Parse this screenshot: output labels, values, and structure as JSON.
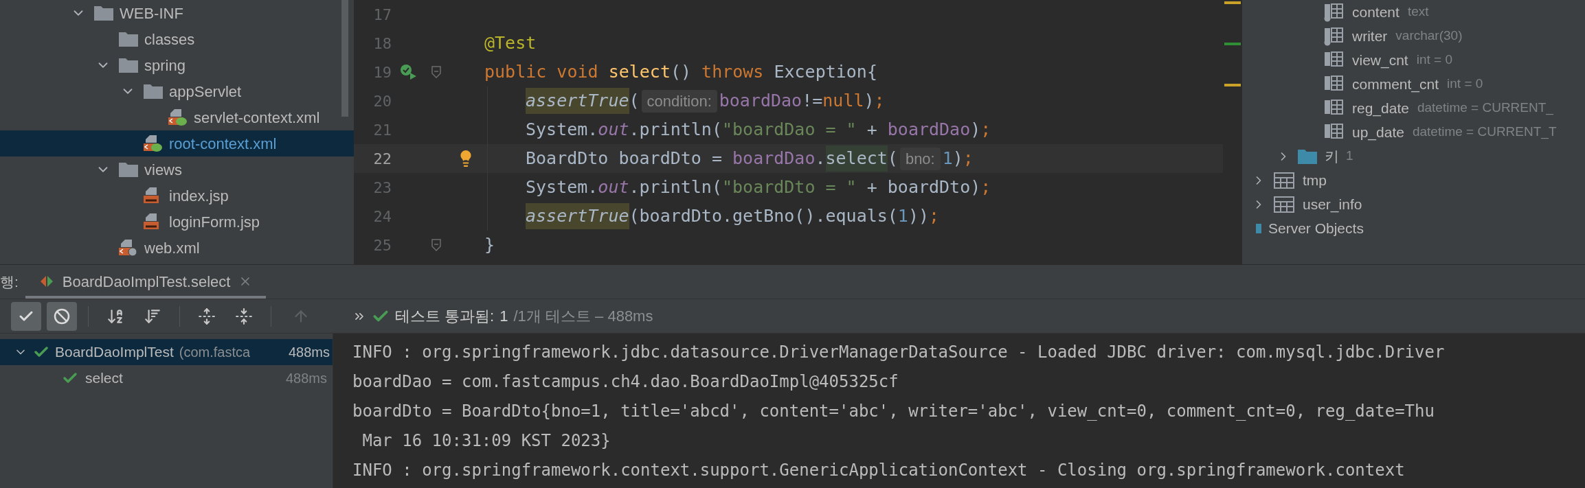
{
  "project_tree": [
    {
      "label": "WEB-INF",
      "kind": "folder",
      "expanded": true,
      "selected": false,
      "children": [
        {
          "label": "classes",
          "kind": "folder",
          "selected": false
        },
        {
          "label": "spring",
          "kind": "folder",
          "expanded": true,
          "selected": false,
          "children": [
            {
              "label": "appServlet",
              "kind": "folder",
              "expanded": true,
              "selected": false,
              "children": [
                {
                  "label": "servlet-context.xml",
                  "kind": "spring-xml",
                  "selected": false
                }
              ]
            },
            {
              "label": "root-context.xml",
              "kind": "spring-xml",
              "selected": true
            }
          ]
        },
        {
          "label": "views",
          "kind": "folder",
          "expanded": true,
          "selected": false,
          "children": [
            {
              "label": "index.jsp",
              "kind": "jsp",
              "selected": false
            },
            {
              "label": "loginForm.jsp",
              "kind": "jsp",
              "selected": false
            }
          ]
        },
        {
          "label": "web.xml",
          "kind": "web-xml",
          "selected": false
        }
      ]
    }
  ],
  "editor": {
    "lines": [
      {
        "number": "17",
        "current": false,
        "indented": false,
        "run_icon": false,
        "bulb_icon": false,
        "fold": false
      },
      {
        "number": "18",
        "current": false,
        "indented": false,
        "run_icon": false,
        "bulb_icon": false,
        "fold": false,
        "tokens": [
          {
            "text": "@Test",
            "kind": "annotation"
          }
        ]
      },
      {
        "number": "19",
        "current": false,
        "indented": false,
        "run_icon": true,
        "bulb_icon": false,
        "fold": true,
        "tokens": [
          {
            "text": "public void",
            "kind": "keyword"
          },
          {
            "text": " select",
            "kind": "method"
          },
          {
            "text": "() ",
            "kind": "plain"
          },
          {
            "text": "throws",
            "kind": "keyword"
          },
          {
            "text": " Exception{",
            "kind": "plain"
          }
        ]
      },
      {
        "number": "20",
        "current": false,
        "indented": true,
        "run_icon": false,
        "bulb_icon": false,
        "fold": false,
        "tokens": [
          {
            "text": "assertTrue",
            "kind": "static"
          },
          {
            "text": "(",
            "kind": "plain"
          },
          {
            "text": "condition:",
            "kind": "hint"
          },
          {
            "text": "boardDao",
            "kind": "field"
          },
          {
            "text": "!=",
            "kind": "plain"
          },
          {
            "text": "null",
            "kind": "keyword"
          },
          {
            "text": ")",
            "kind": "plain"
          },
          {
            "text": ";",
            "kind": "keyword"
          }
        ]
      },
      {
        "number": "21",
        "current": false,
        "indented": true,
        "run_icon": false,
        "bulb_icon": false,
        "fold": false,
        "tokens": [
          {
            "text": "System.",
            "kind": "plain"
          },
          {
            "text": "out",
            "kind": "static-field"
          },
          {
            "text": ".println(",
            "kind": "plain"
          },
          {
            "text": "\"boardDao = \"",
            "kind": "string"
          },
          {
            "text": " + ",
            "kind": "plain"
          },
          {
            "text": "boardDao",
            "kind": "field"
          },
          {
            "text": ")",
            "kind": "plain"
          },
          {
            "text": ";",
            "kind": "keyword"
          }
        ]
      },
      {
        "number": "22",
        "current": true,
        "indented": true,
        "run_icon": false,
        "bulb_icon": true,
        "fold": false,
        "tokens": [
          {
            "text": "BoardDto boardDto = ",
            "kind": "plain"
          },
          {
            "text": "boardDao",
            "kind": "field"
          },
          {
            "text": ".",
            "kind": "plain"
          },
          {
            "text": "select",
            "kind": "usage"
          },
          {
            "text": "(",
            "kind": "plain"
          },
          {
            "text": "bno:",
            "kind": "hint"
          },
          {
            "text": "1",
            "kind": "number"
          },
          {
            "text": ")",
            "kind": "plain"
          },
          {
            "text": ";",
            "kind": "keyword"
          }
        ]
      },
      {
        "number": "23",
        "current": false,
        "indented": true,
        "run_icon": false,
        "bulb_icon": false,
        "fold": false,
        "tokens": [
          {
            "text": "System.",
            "kind": "plain"
          },
          {
            "text": "out",
            "kind": "static-field"
          },
          {
            "text": ".println(",
            "kind": "plain"
          },
          {
            "text": "\"boardDto = \"",
            "kind": "string"
          },
          {
            "text": " + boardDto)",
            "kind": "plain"
          },
          {
            "text": ";",
            "kind": "keyword"
          }
        ]
      },
      {
        "number": "24",
        "current": false,
        "indented": true,
        "run_icon": false,
        "bulb_icon": false,
        "fold": false,
        "tokens": [
          {
            "text": "assertTrue",
            "kind": "static"
          },
          {
            "text": "(boardDto.getBno().equals(",
            "kind": "plain"
          },
          {
            "text": "1",
            "kind": "number"
          },
          {
            "text": "))",
            "kind": "plain"
          },
          {
            "text": ";",
            "kind": "keyword"
          }
        ]
      },
      {
        "number": "25",
        "current": false,
        "indented": false,
        "run_icon": false,
        "bulb_icon": false,
        "fold": true,
        "tokens": [
          {
            "text": "}",
            "kind": "plain"
          }
        ]
      }
    ]
  },
  "db_tree": {
    "columns": [
      {
        "name": "content",
        "type": "text",
        "kind": "required"
      },
      {
        "name": "writer",
        "type": "varchar(30)",
        "kind": "required"
      },
      {
        "name": "view_cnt",
        "type": "int = 0",
        "kind": "column"
      },
      {
        "name": "comment_cnt",
        "type": "int = 0",
        "kind": "column"
      },
      {
        "name": "reg_date",
        "type": "datetime = CURRENT_",
        "kind": "column"
      },
      {
        "name": "up_date",
        "type": "datetime = CURRENT_T",
        "kind": "column"
      }
    ],
    "keys": {
      "label": "키",
      "count": "1",
      "expanded": false
    },
    "tables": [
      {
        "name": "tmp",
        "expanded": false
      },
      {
        "name": "user_info",
        "expanded": false
      }
    ],
    "section": "Server Objects"
  },
  "run_panel": {
    "label": "행:",
    "tabs": [
      {
        "label": "BoardDaoImplTest.select",
        "selected": true
      }
    ],
    "toolbar": {
      "toggles": [
        {
          "kind": "passed",
          "selected": true
        },
        {
          "kind": "ignored",
          "selected": true
        }
      ],
      "navigate_up": {
        "disabled": true
      },
      "status": {
        "label": "테스트 통과됨:",
        "passed": "1",
        "summary": "/1개 테스트 – 488ms"
      }
    },
    "tests": [
      {
        "name": "BoardDaoImplTest",
        "package": "(com.fastca",
        "time": "488ms",
        "expanded": true,
        "selected": true,
        "children": [
          {
            "name": "select",
            "time": "488ms",
            "selected": false
          }
        ]
      }
    ],
    "console": [
      "INFO : org.springframework.jdbc.datasource.DriverManagerDataSource - Loaded JDBC driver: com.mysql.jdbc.Driver",
      "boardDao = com.fastcampus.ch4.dao.BoardDaoImpl@405325cf",
      "boardDto = BoardDto{bno=1, title='abcd', content='abc', writer='abc', view_cnt=0, comment_cnt=0, reg_date=Thu",
      " Mar 16 10:31:09 KST 2023}",
      "INFO : org.springframework.context.support.GenericApplicationContext - Closing org.springframework.context"
    ]
  }
}
